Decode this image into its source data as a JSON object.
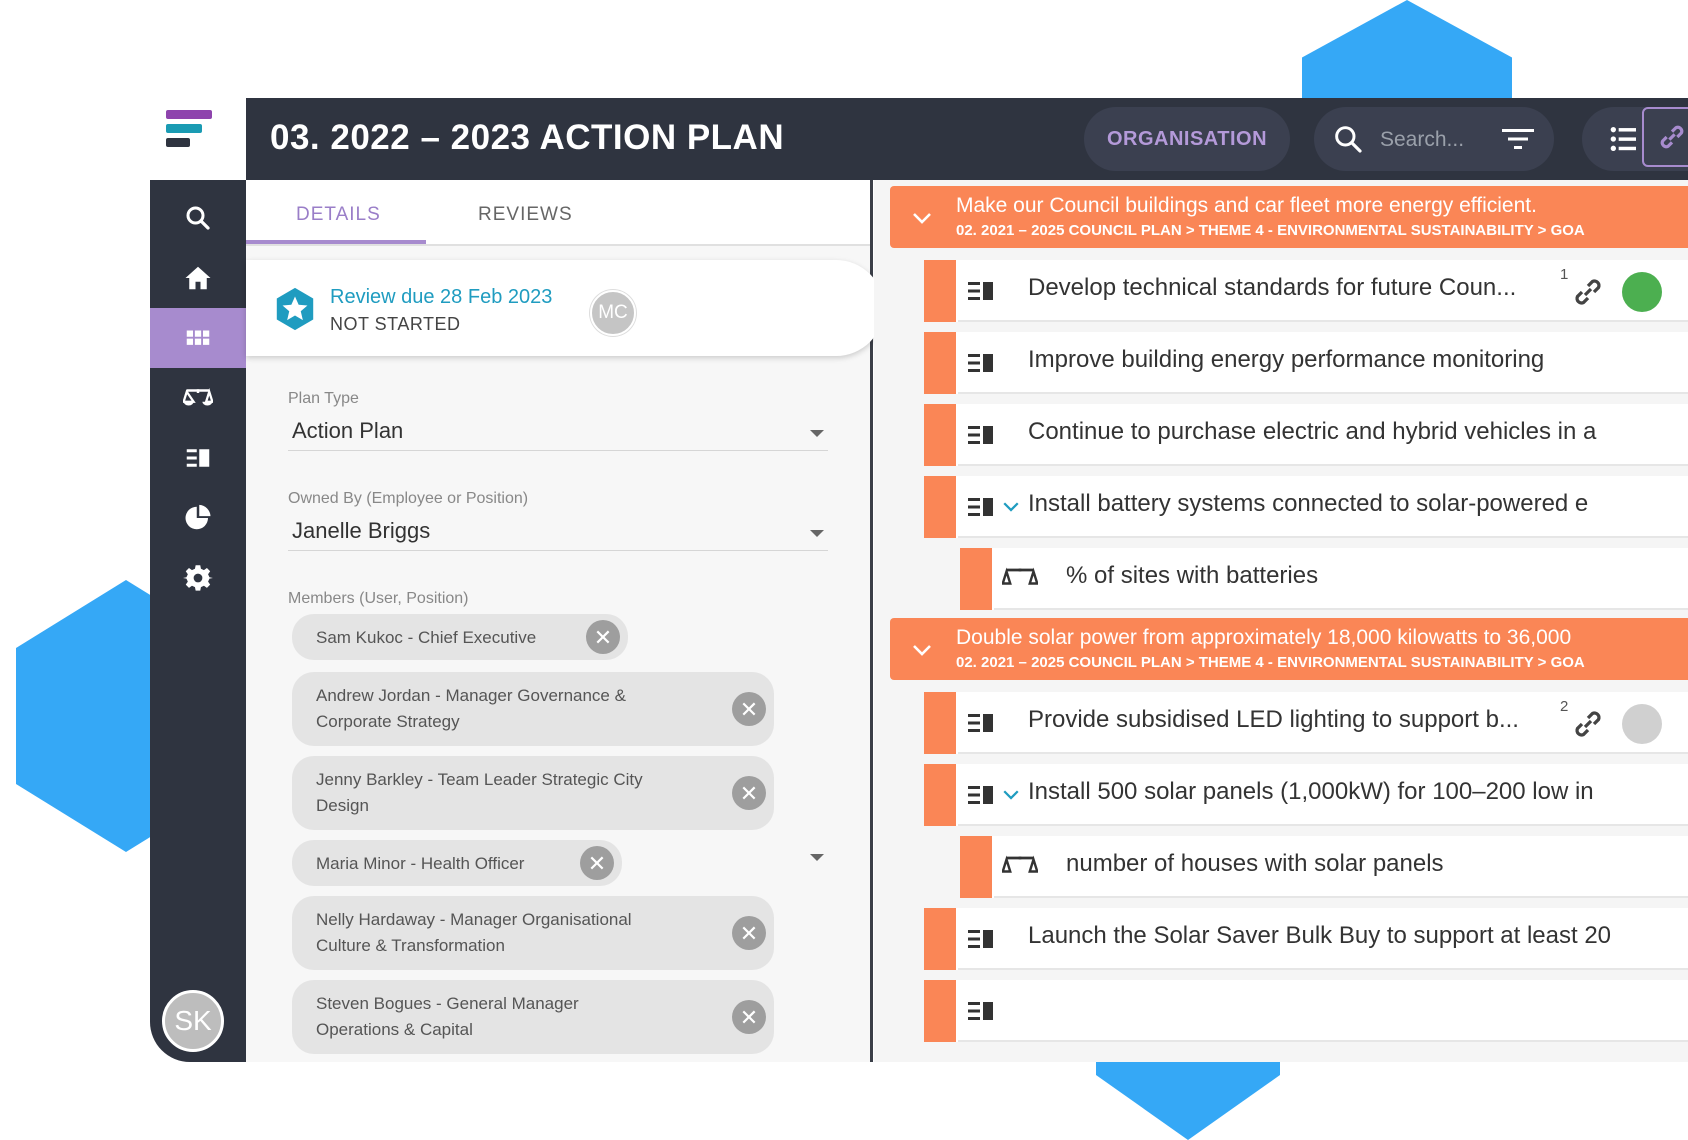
{
  "header": {
    "title": "03. 2022 – 2023 ACTION PLAN",
    "org_label": "ORGANISATION",
    "search_placeholder": "Search..."
  },
  "sidebar": {
    "items": [
      "search-icon",
      "home-icon",
      "grid-icon",
      "scales-icon",
      "list-bars-icon",
      "pie-chart-icon",
      "gear-icon"
    ],
    "active_index": 2,
    "user_initials": "SK"
  },
  "tabs": [
    {
      "label": "DETAILS",
      "active": true
    },
    {
      "label": "REVIEWS",
      "active": false
    }
  ],
  "review": {
    "due": "Review due 28 Feb 2023",
    "status": "NOT STARTED",
    "assignee_initials": "MC"
  },
  "fields": {
    "plan_type_label": "Plan Type",
    "plan_type_value": "Action Plan",
    "owner_label": "Owned By (Employee or Position)",
    "owner_value": "Janelle Briggs",
    "members_label": "Members (User, Position)"
  },
  "members": [
    {
      "line1": "Sam Kukoc - Chief Executive",
      "line2": ""
    },
    {
      "line1": "Andrew Jordan - Manager Governance &",
      "line2": "Corporate Strategy"
    },
    {
      "line1": "Jenny Barkley - Team Leader Strategic City",
      "line2": "Design"
    },
    {
      "line1": "Maria Minor - Health Officer",
      "line2": ""
    },
    {
      "line1": "Nelly Hardaway - Manager Organisational",
      "line2": "Culture & Transformation"
    },
    {
      "line1": "Steven Bogues - General Manager",
      "line2": "Operations & Capital"
    }
  ],
  "goals": [
    {
      "title": "Make our Council buildings and car fleet more energy efficient.",
      "path": "02. 2021 – 2025 COUNCIL PLAN > THEME 4 - ENVIRONMENTAL SUSTAINABILITY > GOA",
      "items": [
        {
          "text": "Develop technical standards for future Coun...",
          "sup": "1"
        },
        {
          "text": "Improve building energy performance monitoring"
        },
        {
          "text": "Continue to purchase electric and hybrid vehicles in a"
        },
        {
          "text": "Install battery systems connected to solar-powered e"
        },
        {
          "text": "% of sites with batteries"
        }
      ]
    },
    {
      "title": "Double solar power from approximately 18,000 kilowatts to 36,000",
      "path": "02. 2021 – 2025 COUNCIL PLAN > THEME 4 - ENVIRONMENTAL SUSTAINABILITY > GOA",
      "items": [
        {
          "text": "Provide subsidised LED lighting to support b...",
          "sup": "2"
        },
        {
          "text": "Install 500 solar panels (1,000kW) for 100–200 low in"
        },
        {
          "text": "number of houses with solar panels"
        },
        {
          "text": "Launch the Solar Saver Bulk Buy to support at least 20"
        }
      ]
    }
  ],
  "colors": {
    "accent_purple": "#a78bce",
    "goal_orange": "#fa8656",
    "header_dark": "#2f3440",
    "hex_blue": "#35a8f6",
    "status_green": "#4caf50"
  }
}
